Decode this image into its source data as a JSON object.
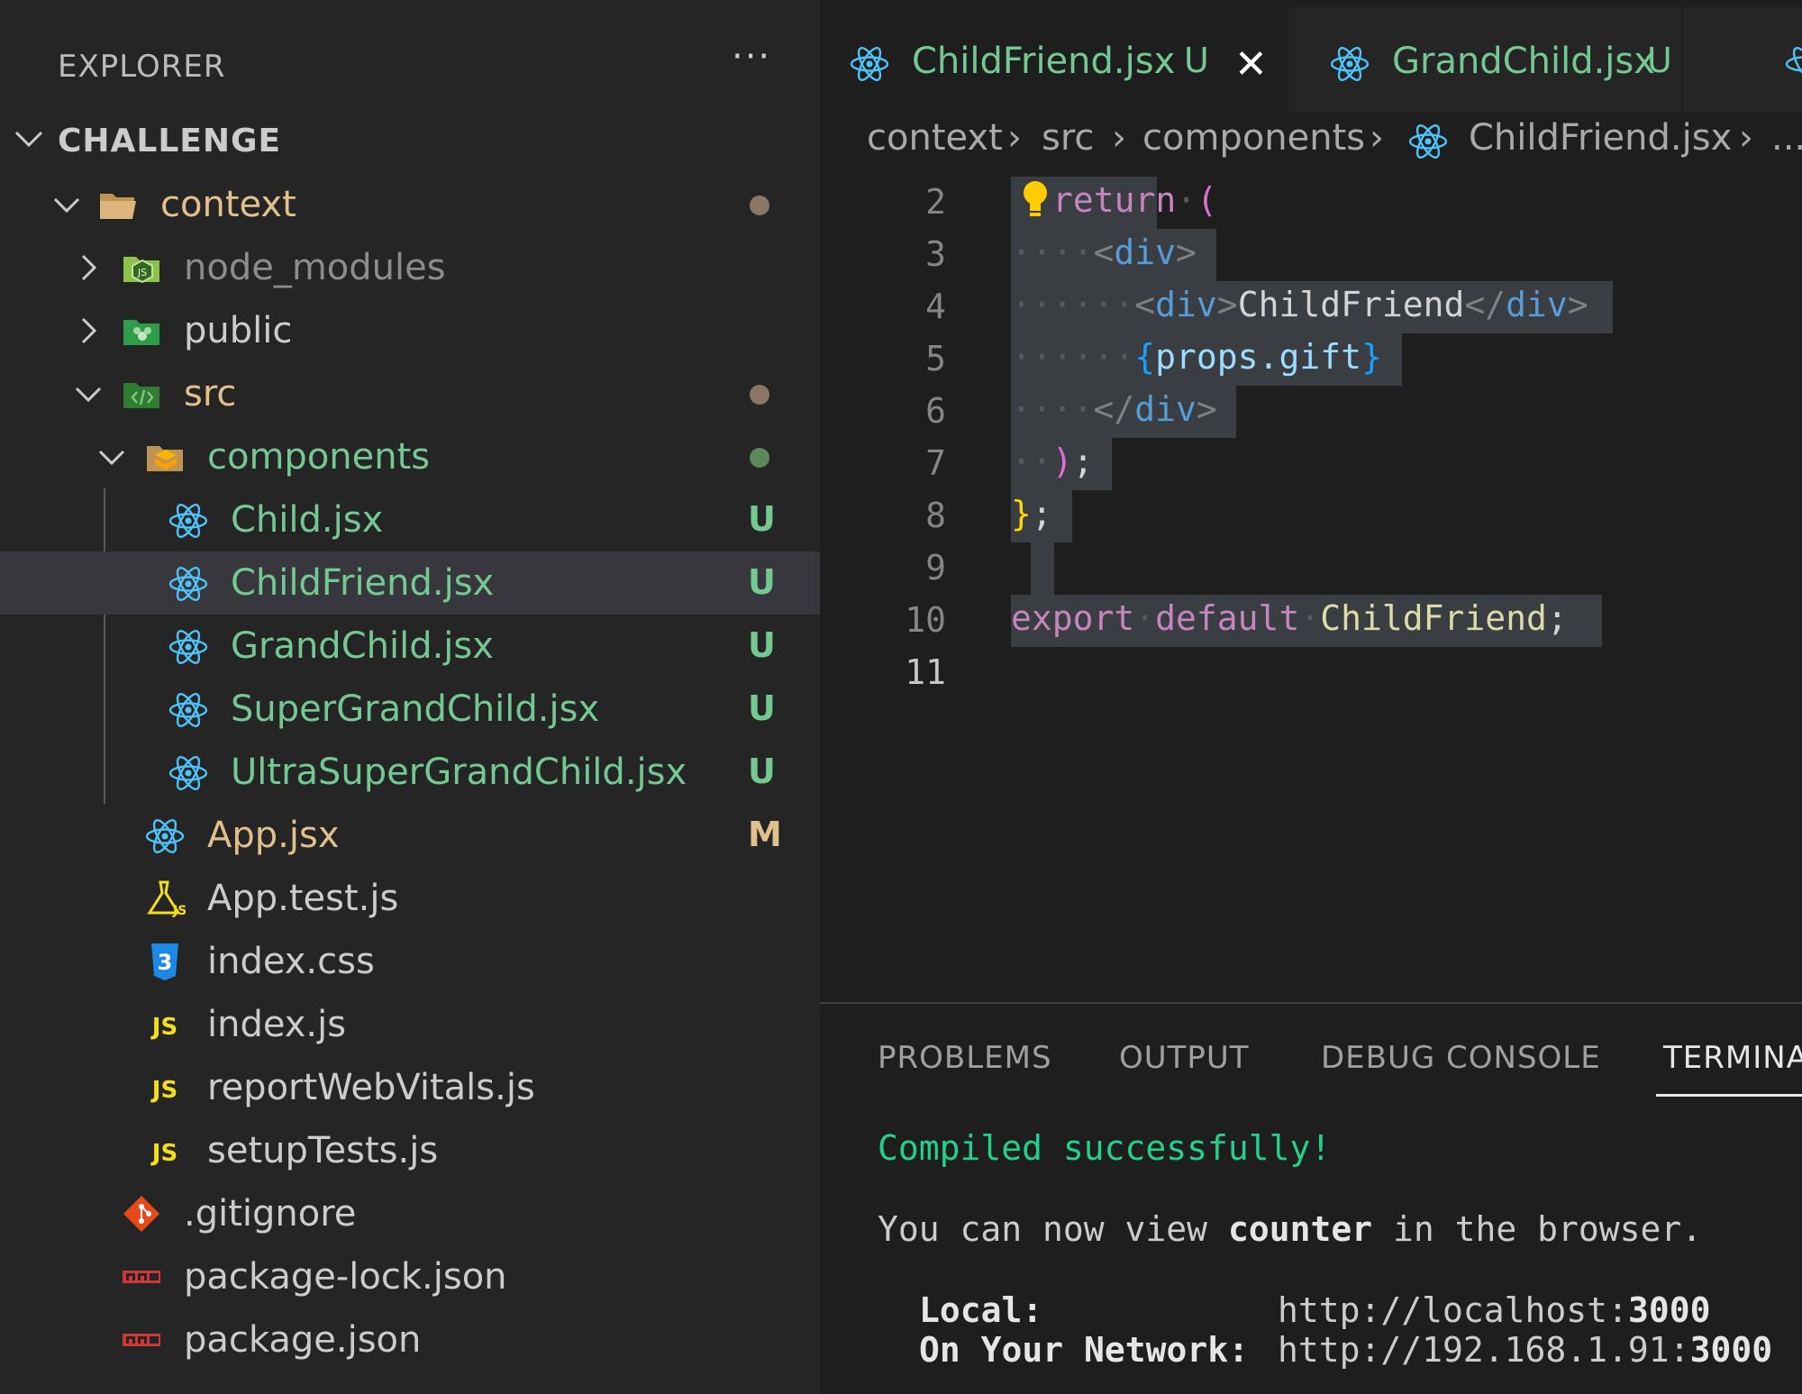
{
  "explorer": {
    "title": "EXPLORER",
    "more": "···",
    "section": "CHALLENGE",
    "tree": [
      {
        "name": "context",
        "kind": "folder-open",
        "status": "dot",
        "statusColor": "#8b7765"
      },
      {
        "name": "node_modules",
        "kind": "folder-node"
      },
      {
        "name": "public",
        "kind": "folder-public"
      },
      {
        "name": "src",
        "kind": "folder-src",
        "status": "dot",
        "statusColor": "#8b7765"
      },
      {
        "name": "components",
        "kind": "folder-components",
        "status": "dot",
        "statusColor": "#5a8a5a"
      },
      {
        "name": "Child.jsx",
        "kind": "react",
        "badge": "U"
      },
      {
        "name": "ChildFriend.jsx",
        "kind": "react",
        "badge": "U",
        "selected": true
      },
      {
        "name": "GrandChild.jsx",
        "kind": "react",
        "badge": "U"
      },
      {
        "name": "SuperGrandChild.jsx",
        "kind": "react",
        "badge": "U"
      },
      {
        "name": "UltraSuperGrandChild.jsx",
        "kind": "react",
        "badge": "U"
      },
      {
        "name": "App.jsx",
        "kind": "react",
        "badge": "M"
      },
      {
        "name": "App.test.js",
        "kind": "test"
      },
      {
        "name": "index.css",
        "kind": "css"
      },
      {
        "name": "index.js",
        "kind": "js"
      },
      {
        "name": "reportWebVitals.js",
        "kind": "js"
      },
      {
        "name": "setupTests.js",
        "kind": "js"
      },
      {
        "name": ".gitignore",
        "kind": "git"
      },
      {
        "name": "package-lock.json",
        "kind": "npm"
      },
      {
        "name": "package.json",
        "kind": "npm"
      }
    ]
  },
  "tabs": [
    {
      "name": "ChildFriend.jsx",
      "badge": "U",
      "active": true,
      "close": "✕"
    },
    {
      "name": "GrandChild.jsx",
      "badge": "U",
      "active": false
    }
  ],
  "breadcrumb": {
    "parts": [
      "context",
      "src",
      "components",
      "ChildFriend.jsx"
    ],
    "sep": "›",
    "more": "..."
  },
  "code": {
    "line_numbers": [
      "2",
      "3",
      "4",
      "5",
      "6",
      "7",
      "8",
      "9",
      "10",
      "11"
    ],
    "current_line": "11",
    "lines": {
      "l2": {
        "kw": "return",
        "paren": "("
      },
      "l3": {
        "open": "<",
        "tag": "div",
        "close": ">"
      },
      "l4": {
        "tag": "div",
        "text": "ChildFriend"
      },
      "l5": {
        "open": "{",
        "expr": "props.gift",
        "close": "}"
      },
      "l6": {
        "tag": "div"
      },
      "l7": {
        "paren": ")",
        "semi": ";"
      },
      "l8": {
        "brace": "}",
        "semi": ";"
      },
      "l10": {
        "kw1": "export",
        "kw2": "default",
        "ident": "ChildFriend",
        "semi": ";"
      }
    }
  },
  "panel": {
    "tabs": [
      "PROBLEMS",
      "OUTPUT",
      "DEBUG CONSOLE",
      "TERMINA"
    ],
    "active_tab": "TERMINA",
    "terminal": {
      "compiled": "Compiled successfully!",
      "view_prefix": "You can now view ",
      "view_app": "counter",
      "view_suffix": " in the browser.",
      "local_label": "Local:",
      "local_url": "http://localhost:",
      "local_port": "3000",
      "network_label": "On Your Network:",
      "network_url": "http://192.168.1.91:",
      "network_port": "3000"
    }
  },
  "colors": {
    "untracked": "#73c991",
    "modified": "#e2c08d",
    "react": "#4fc3f7",
    "js": "#f5de19",
    "terminal_green": "#23d18b"
  }
}
